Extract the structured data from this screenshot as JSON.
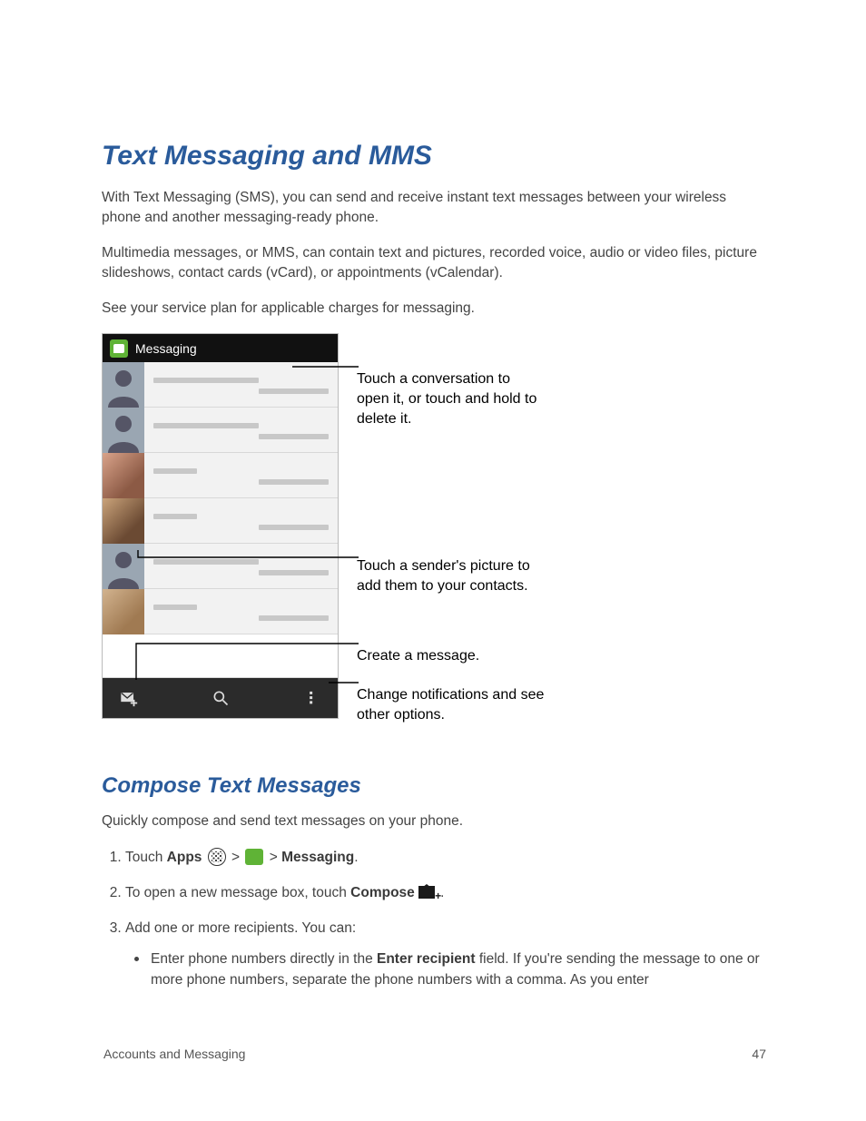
{
  "heading": "Text Messaging and MMS",
  "para1": "With Text Messaging (SMS), you can send and receive instant text messages between your wireless phone and another messaging-ready phone.",
  "para2": "Multimedia messages, or MMS, can contain text and pictures, recorded voice, audio or video files, picture slideshows, contact cards (vCard), or appointments (vCalendar).",
  "para3": "See your service plan for applicable charges for messaging.",
  "phone": {
    "app_title": "Messaging"
  },
  "callouts": {
    "c1": "Touch a conversation to open it, or touch and hold to delete it.",
    "c2": "Touch a sender's picture  to add them to your contacts.",
    "c3": "Create a message.",
    "c4": "Change notifications and see other options."
  },
  "subheading": "Compose Text Messages",
  "sub_intro": "Quickly compose and send text messages on your phone.",
  "step1": {
    "pre": "Touch ",
    "apps": "Apps",
    "gt1": " > ",
    "gt2": " > ",
    "messaging": "Messaging",
    "dot": "."
  },
  "step2": {
    "pre": "To open a new message box, touch ",
    "compose": "Compose",
    "dot": "."
  },
  "step3": {
    "text": "Add one or more recipients. You can:",
    "bullet_pre": "Enter phone numbers directly in the ",
    "bullet_bold": "Enter recipient",
    "bullet_post": " field. If you're sending the message to one or more phone numbers, separate the phone numbers with a comma. As you enter"
  },
  "footer": {
    "section": "Accounts and Messaging",
    "page": "47"
  }
}
